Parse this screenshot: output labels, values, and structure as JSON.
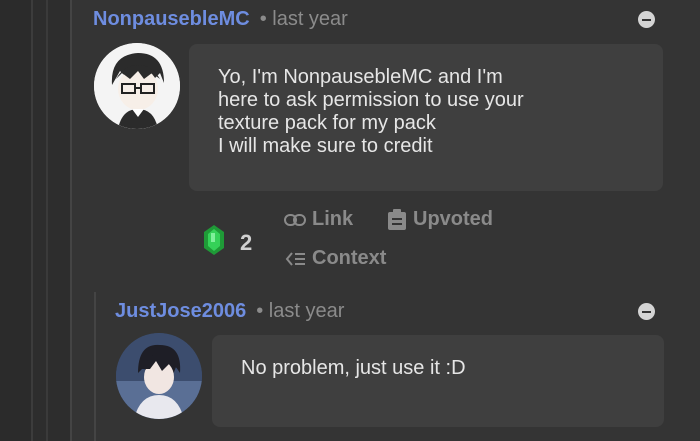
{
  "comments": [
    {
      "username": "NonpausebleMC",
      "time": "• last year",
      "body_lines": [
        "Yo, I'm NonpausebleMC and I'm",
        "here to ask permission to use your",
        "texture pack for my pack",
        "I will make sure to credit"
      ],
      "votes": "2",
      "actions": {
        "link": "Link",
        "upvoted": "Upvoted",
        "context": "Context"
      }
    },
    {
      "username": "JustJose2006",
      "time": "• last year",
      "body_lines": [
        "No problem, just use it :D"
      ]
    }
  ],
  "icons": {
    "collapse": "minus-circle-icon",
    "vote": "emerald-icon",
    "link": "link-icon",
    "upvoted": "clipboard-icon",
    "context": "context-icon"
  },
  "colors": {
    "username": "#6e8de0",
    "background": "#2d2d2d",
    "card": "#343434",
    "bubble": "#3f3f3f",
    "emerald": "#2fbf4a"
  }
}
